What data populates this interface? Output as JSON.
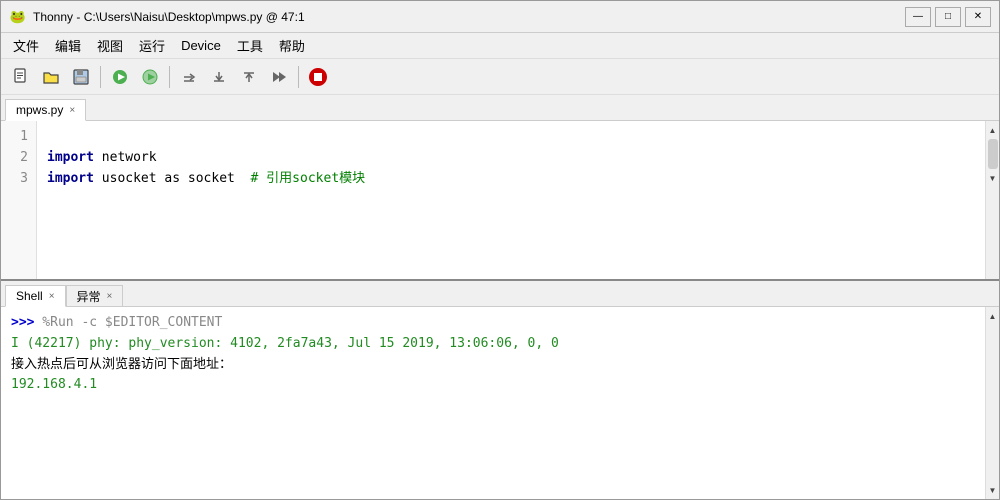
{
  "titlebar": {
    "icon": "🐸",
    "title": "Thonny - C:\\Users\\Naisu\\Desktop\\mpws.py @ 47:1",
    "minimize": "—",
    "maximize": "□",
    "close": "✕"
  },
  "menubar": {
    "items": [
      "文件",
      "编辑",
      "视图",
      "运行",
      "Device",
      "工具",
      "帮助"
    ]
  },
  "toolbar": {
    "buttons": [
      {
        "name": "new-button",
        "icon": "📄"
      },
      {
        "name": "open-button",
        "icon": "📂"
      },
      {
        "name": "save-button",
        "icon": "💾"
      },
      {
        "name": "run-button",
        "icon": "▶"
      },
      {
        "name": "debug-button",
        "icon": "🐛"
      },
      {
        "name": "step-over-button",
        "icon": "↷"
      },
      {
        "name": "step-into-button",
        "icon": "↡"
      },
      {
        "name": "step-out-button",
        "icon": "↑"
      },
      {
        "name": "resume-button",
        "icon": "⏩"
      },
      {
        "name": "stop-button",
        "icon": "⛔"
      }
    ]
  },
  "editor": {
    "tab_label": "mpws.py",
    "tab_close": "×",
    "lines": [
      {
        "num": 1,
        "content": "import network"
      },
      {
        "num": 2,
        "content": "import usocket as socket  # 引用socket模块"
      },
      {
        "num": 3,
        "content": ""
      }
    ]
  },
  "shell": {
    "tabs": [
      {
        "label": "Shell",
        "close": "×"
      },
      {
        "label": "异常",
        "close": "×"
      }
    ],
    "prompt": ">>>",
    "command": " %Run -c $EDITOR_CONTENT",
    "output_line1": "I (42217) phy: phy_version: 4102, 2fa7a43, Jul 15 2019, 13:06:06, 0, 0",
    "output_line2": "接入热点后可从浏览器访问下面地址：",
    "output_line3": "192.168.4.1"
  },
  "colors": {
    "keyword": "#00008b",
    "comment": "#008000",
    "shell_info": "#228B22",
    "shell_prompt": "#0000cc"
  }
}
